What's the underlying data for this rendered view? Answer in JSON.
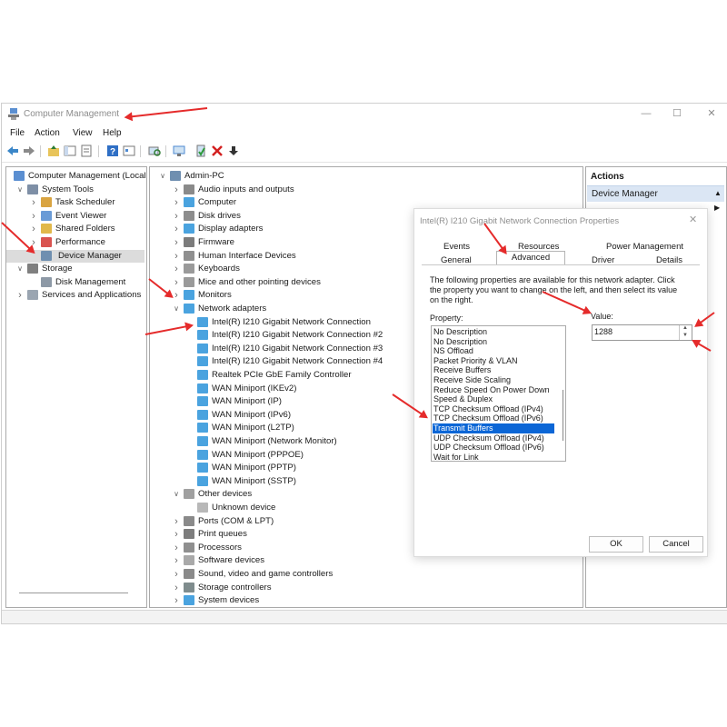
{
  "window": {
    "title": "Computer Management",
    "controls": [
      "minimize",
      "maximize",
      "close"
    ]
  },
  "menu": [
    "File",
    "Action",
    "View",
    "Help"
  ],
  "left_tree": [
    {
      "label": "Computer Management (Local",
      "level": 0,
      "toggle": "",
      "icon": "computer-management-icon"
    },
    {
      "label": "System Tools",
      "level": 1,
      "toggle": "v",
      "icon": "system-tools-icon"
    },
    {
      "label": "Task Scheduler",
      "level": 2,
      "toggle": ">",
      "icon": "clock-icon"
    },
    {
      "label": "Event Viewer",
      "level": 2,
      "toggle": ">",
      "icon": "event-viewer-icon"
    },
    {
      "label": "Shared Folders",
      "level": 2,
      "toggle": ">",
      "icon": "shared-folder-icon"
    },
    {
      "label": "Performance",
      "level": 2,
      "toggle": ">",
      "icon": "performance-icon"
    },
    {
      "label": "Device Manager",
      "level": 2,
      "toggle": "",
      "icon": "device-manager-icon",
      "selected": true
    },
    {
      "label": "Storage",
      "level": 1,
      "toggle": "v",
      "icon": "storage-icon"
    },
    {
      "label": "Disk Management",
      "level": 2,
      "toggle": "",
      "icon": "disk-management-icon"
    },
    {
      "label": "Services and Applications",
      "level": 1,
      "toggle": ">",
      "icon": "services-icon"
    }
  ],
  "device_tree": [
    {
      "label": "Admin-PC",
      "level": 0,
      "toggle": "v",
      "icon": "pc-icon"
    },
    {
      "label": "Audio inputs and outputs",
      "level": 1,
      "toggle": ">",
      "icon": "audio-icon"
    },
    {
      "label": "Computer",
      "level": 1,
      "toggle": ">",
      "icon": "computer-icon"
    },
    {
      "label": "Disk drives",
      "level": 1,
      "toggle": ">",
      "icon": "disk-drive-icon"
    },
    {
      "label": "Display adapters",
      "level": 1,
      "toggle": ">",
      "icon": "display-adapter-icon"
    },
    {
      "label": "Firmware",
      "level": 1,
      "toggle": ">",
      "icon": "firmware-icon"
    },
    {
      "label": "Human Interface Devices",
      "level": 1,
      "toggle": ">",
      "icon": "hid-icon"
    },
    {
      "label": "Keyboards",
      "level": 1,
      "toggle": ">",
      "icon": "keyboard-icon"
    },
    {
      "label": "Mice and other pointing devices",
      "level": 1,
      "toggle": ">",
      "icon": "mouse-icon"
    },
    {
      "label": "Monitors",
      "level": 1,
      "toggle": ">",
      "icon": "monitor-icon"
    },
    {
      "label": "Network adapters",
      "level": 1,
      "toggle": "v",
      "icon": "network-adapter-icon"
    },
    {
      "label": "Intel(R) I210 Gigabit Network Connection",
      "level": 2,
      "toggle": "",
      "icon": "network-adapter-icon"
    },
    {
      "label": "Intel(R) I210 Gigabit Network Connection #2",
      "level": 2,
      "toggle": "",
      "icon": "network-adapter-icon"
    },
    {
      "label": "Intel(R) I210 Gigabit Network Connection #3",
      "level": 2,
      "toggle": "",
      "icon": "network-adapter-icon"
    },
    {
      "label": "Intel(R) I210 Gigabit Network Connection #4",
      "level": 2,
      "toggle": "",
      "icon": "network-adapter-icon"
    },
    {
      "label": "Realtek PCIe GbE Family Controller",
      "level": 2,
      "toggle": "",
      "icon": "network-adapter-icon"
    },
    {
      "label": "WAN Miniport (IKEv2)",
      "level": 2,
      "toggle": "",
      "icon": "network-adapter-icon"
    },
    {
      "label": "WAN Miniport (IP)",
      "level": 2,
      "toggle": "",
      "icon": "network-adapter-icon"
    },
    {
      "label": "WAN Miniport (IPv6)",
      "level": 2,
      "toggle": "",
      "icon": "network-adapter-icon"
    },
    {
      "label": "WAN Miniport (L2TP)",
      "level": 2,
      "toggle": "",
      "icon": "network-adapter-icon"
    },
    {
      "label": "WAN Miniport (Network Monitor)",
      "level": 2,
      "toggle": "",
      "icon": "network-adapter-icon"
    },
    {
      "label": "WAN Miniport (PPPOE)",
      "level": 2,
      "toggle": "",
      "icon": "network-adapter-icon"
    },
    {
      "label": "WAN Miniport (PPTP)",
      "level": 2,
      "toggle": "",
      "icon": "network-adapter-icon"
    },
    {
      "label": "WAN Miniport (SSTP)",
      "level": 2,
      "toggle": "",
      "icon": "network-adapter-icon"
    },
    {
      "label": "Other devices",
      "level": 1,
      "toggle": "v",
      "icon": "other-devices-icon"
    },
    {
      "label": "Unknown device",
      "level": 2,
      "toggle": "",
      "icon": "unknown-device-icon"
    },
    {
      "label": "Ports (COM & LPT)",
      "level": 1,
      "toggle": ">",
      "icon": "ports-icon"
    },
    {
      "label": "Print queues",
      "level": 1,
      "toggle": ">",
      "icon": "printer-icon"
    },
    {
      "label": "Processors",
      "level": 1,
      "toggle": ">",
      "icon": "processor-icon"
    },
    {
      "label": "Software devices",
      "level": 1,
      "toggle": ">",
      "icon": "software-device-icon"
    },
    {
      "label": "Sound, video and game controllers",
      "level": 1,
      "toggle": ">",
      "icon": "sound-icon"
    },
    {
      "label": "Storage controllers",
      "level": 1,
      "toggle": ">",
      "icon": "storage-controller-icon"
    },
    {
      "label": "System devices",
      "level": 1,
      "toggle": ">",
      "icon": "system-device-icon"
    }
  ],
  "actions_pane": {
    "header": "Actions",
    "selected_item": "Device Manager"
  },
  "dialog": {
    "title": "Intel(R) I210 Gigabit Network Connection Properties",
    "tabs_back": [
      "Events",
      "Resources",
      "Power Management"
    ],
    "tabs_front": [
      "General",
      "Advanced",
      "Driver",
      "Details"
    ],
    "active_tab": "Advanced",
    "description": "The following properties are available for this network adapter. Click the property you want to change on the left, and then select its value on the right.",
    "property_label": "Property:",
    "value_label": "Value:",
    "value": "1288",
    "properties": [
      "No Description",
      "No Description",
      "NS Offload",
      "Packet Priority & VLAN",
      "Receive Buffers",
      "Receive Side Scaling",
      "Reduce Speed On Power Down",
      "Speed & Duplex",
      "TCP Checksum Offload (IPv4)",
      "TCP Checksum Offload (IPv6)",
      "Transmit Buffers",
      "UDP Checksum Offload (IPv4)",
      "UDP Checksum Offload (IPv6)",
      "Wait for Link"
    ],
    "selected_property": "Transmit Buffers",
    "ok_label": "OK",
    "cancel_label": "Cancel"
  },
  "colors": {
    "selection_blue": "#0b66d6",
    "annotation_red": "#e52b2b",
    "tree_highlight": "#dcdcdc"
  }
}
